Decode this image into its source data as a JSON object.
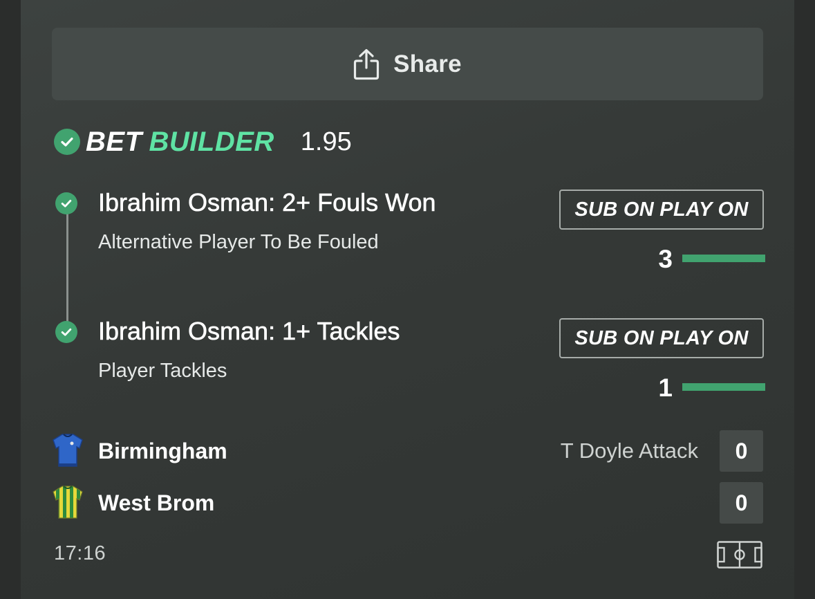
{
  "share": {
    "label": "Share",
    "icon": "share-icon"
  },
  "bet_builder": {
    "word1": "BET",
    "word2": "BUILDER",
    "odds": "1.95",
    "accent_color": "#5fe3a4",
    "check_color": "#41a36f"
  },
  "legs": [
    {
      "title": "Ibrahim Osman: 2+ Fouls Won",
      "subtitle": "Alternative Player To Be Fouled",
      "badge": "SUB ON PLAY ON",
      "progress_value": "3",
      "progress_fill": 1.0
    },
    {
      "title": "Ibrahim Osman: 1+ Tackles",
      "subtitle": "Player Tackles",
      "badge": "SUB ON PLAY ON",
      "progress_value": "1",
      "progress_fill": 1.0
    }
  ],
  "match": {
    "home": {
      "name": "Birmingham",
      "event": "T Doyle Attack",
      "score": "0",
      "jersey_icon": "blue-jersey-icon"
    },
    "away": {
      "name": "West Brom",
      "score": "0",
      "jersey_icon": "green-yellow-striped-jersey-icon"
    },
    "time": "17:16",
    "pitch_icon": "pitch-icon"
  }
}
